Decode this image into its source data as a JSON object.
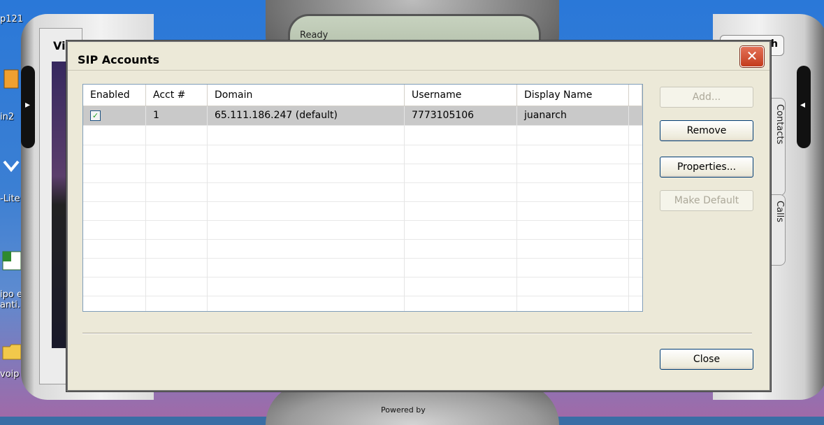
{
  "desktop": {
    "icons": [
      {
        "label": "p121",
        "icon": "shortcut-icon"
      },
      {
        "label": "in2",
        "icon": "sim-card-icon"
      },
      {
        "label": "-Lite",
        "icon": "x-lite-icon"
      },
      {
        "label": "ipo e anti.",
        "icon": "excel-file-icon"
      },
      {
        "label": "voip",
        "icon": "folder-icon"
      }
    ]
  },
  "softphone": {
    "status_text": "Ready",
    "left_label": "Vi",
    "search_label": "h",
    "tabs": [
      "Contacts",
      "Calls"
    ],
    "powered_by": "Powered by"
  },
  "dialog": {
    "title": "SIP Accounts",
    "close_glyph": "✕",
    "table": {
      "columns": [
        "Enabled",
        "Acct #",
        "Domain",
        "Username",
        "Display Name"
      ],
      "rows": [
        {
          "enabled": true,
          "acct": "1",
          "domain": "65.111.186.247 (default)",
          "username": "7773105106",
          "display_name": "juanarch"
        }
      ],
      "empty_rows": 10
    },
    "buttons": {
      "add": "Add...",
      "remove": "Remove",
      "properties": "Properties...",
      "make_default": "Make Default",
      "close": "Close"
    }
  },
  "colors": {
    "dialog_bg": "#ece9d8",
    "selected_row": "#c9c9c9",
    "close_button": "#c33b1d",
    "button_border": "#003c74"
  }
}
